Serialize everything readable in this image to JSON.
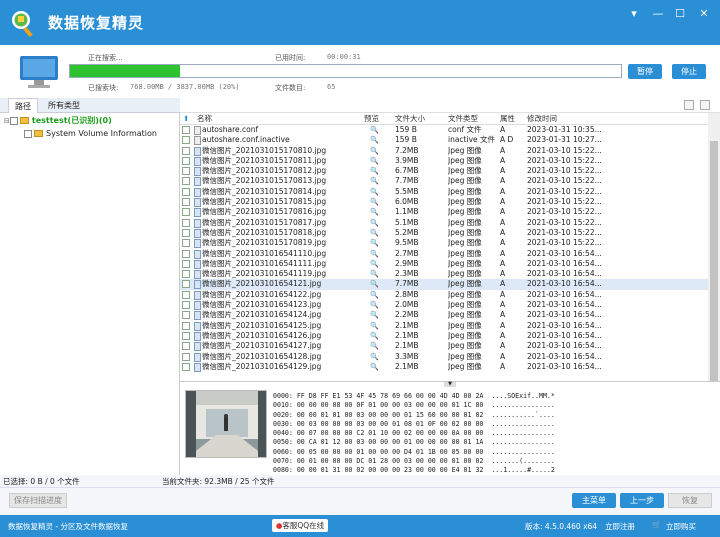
{
  "app": {
    "title": "数据恢复精灵",
    "footer_left": "数据恢复精灵 - 分区及文件数据恢复",
    "footer_service": "客服QQ在线",
    "version": "版本: 4.5.0.460 x64",
    "register": "立即注册",
    "buy": "立即购买"
  },
  "scan": {
    "status_label": "正在搜索...",
    "elapsed_label": "已用时间:",
    "elapsed": "00:00:31",
    "searched_label": "已搜索块:",
    "searched": "768.00MB / 3837.00MB (20%)",
    "files_label": "文件数目:",
    "files": "65",
    "progress": 0.2,
    "pause": "暂停",
    "stop": "停止"
  },
  "tabs": [
    "路径",
    "所有类型"
  ],
  "tree": [
    {
      "label": "testtest(已识别)(0)"
    },
    {
      "label": "System Volume Information"
    }
  ],
  "columns": {
    "name": "名称",
    "preview": "预览",
    "size": "文件大小",
    "type": "文件类型",
    "attr": "属性",
    "modified": "修改时间"
  },
  "files": [
    {
      "name": "autoshare.conf",
      "size": "159 B",
      "type": "conf 文件",
      "attr": "A",
      "time": "2023-01-31 10:35...",
      "icon": "cfg"
    },
    {
      "name": "autoshare.conf.inactive",
      "size": "159 B",
      "type": "inactive 文件",
      "attr": "A D",
      "time": "2023-01-31 10:27...",
      "icon": "cfg"
    },
    {
      "name": "微信图片_20210310151708​10.jpg",
      "size": "7.2MB",
      "type": "Jpeg 图像",
      "attr": "A",
      "time": "2021-03-10 15:22...",
      "icon": "jpg"
    },
    {
      "name": "微信图片_202103101517081​1.jpg",
      "size": "3.9MB",
      "type": "Jpeg 图像",
      "attr": "A",
      "time": "2021-03-10 15:22...",
      "icon": "jpg"
    },
    {
      "name": "微信图片_20210310151708​12.jpg",
      "size": "6.7MB",
      "type": "Jpeg 图像",
      "attr": "A",
      "time": "2021-03-10 15:22...",
      "icon": "jpg"
    },
    {
      "name": "微信图片_20210310151708​13.jpg",
      "size": "7.7MB",
      "type": "Jpeg 图像",
      "attr": "A",
      "time": "2021-03-10 15:22...",
      "icon": "jpg"
    },
    {
      "name": "微信图片_20210310151708​14.jpg",
      "size": "5.5MB",
      "type": "Jpeg 图像",
      "attr": "A",
      "time": "2021-03-10 15:22...",
      "icon": "jpg"
    },
    {
      "name": "微信图片_20210310151708​15.jpg",
      "size": "6.0MB",
      "type": "Jpeg 图像",
      "attr": "A",
      "time": "2021-03-10 15:22...",
      "icon": "jpg"
    },
    {
      "name": "微信图片_20210310151708​16.jpg",
      "size": "1.1MB",
      "type": "Jpeg 图像",
      "attr": "A",
      "time": "2021-03-10 15:22...",
      "icon": "jpg"
    },
    {
      "name": "微信图片_20210310151708​17.jpg",
      "size": "5.1MB",
      "type": "Jpeg 图像",
      "attr": "A",
      "time": "2021-03-10 15:22...",
      "icon": "jpg"
    },
    {
      "name": "微信图片_20210310151708​18.jpg",
      "size": "5.2MB",
      "type": "Jpeg 图像",
      "attr": "A",
      "time": "2021-03-10 15:22...",
      "icon": "jpg"
    },
    {
      "name": "微信图片_20210310151708​19.jpg",
      "size": "9.5MB",
      "type": "Jpeg 图像",
      "attr": "A",
      "time": "2021-03-10 15:22...",
      "icon": "jpg"
    },
    {
      "name": "微信图片_20210310165411​10.jpg",
      "size": "2.7MB",
      "type": "Jpeg 图像",
      "attr": "A",
      "time": "2021-03-10 16:54...",
      "icon": "jpg"
    },
    {
      "name": "微信图片_20210310165411​11.jpg",
      "size": "2.9MB",
      "type": "Jpeg 图像",
      "attr": "A",
      "time": "2021-03-10 16:54...",
      "icon": "jpg"
    },
    {
      "name": "微信图片_20210310165411​19.jpg",
      "size": "2.3MB",
      "type": "Jpeg 图像",
      "attr": "A",
      "time": "2021-03-10 16:54...",
      "icon": "jpg"
    },
    {
      "name": "微信图片_20210310165412​1.jpg",
      "size": "7.7MB",
      "type": "Jpeg 图像",
      "attr": "A",
      "time": "2021-03-10 16:54...",
      "icon": "jpg",
      "selected": true
    },
    {
      "name": "微信图片_20210310165412​2.jpg",
      "size": "2.8MB",
      "type": "Jpeg 图像",
      "attr": "A",
      "time": "2021-03-10 16:54...",
      "icon": "jpg"
    },
    {
      "name": "微信图片_20210310165412​3.jpg",
      "size": "2.0MB",
      "type": "Jpeg 图像",
      "attr": "A",
      "time": "2021-03-10 16:54...",
      "icon": "jpg"
    },
    {
      "name": "微信图片_20210310165412​4.jpg",
      "size": "2.2MB",
      "type": "Jpeg 图像",
      "attr": "A",
      "time": "2021-03-10 16:54...",
      "icon": "jpg"
    },
    {
      "name": "微信图片_20210310165412​5.jpg",
      "size": "2.1MB",
      "type": "Jpeg 图像",
      "attr": "A",
      "time": "2021-03-10 16:54...",
      "icon": "jpg"
    },
    {
      "name": "微信图片_20210310165412​6.jpg",
      "size": "2.1MB",
      "type": "Jpeg 图像",
      "attr": "A",
      "time": "2021-03-10 16:54...",
      "icon": "jpg"
    },
    {
      "name": "微信图片_20210310165412​7.jpg",
      "size": "2.1MB",
      "type": "Jpeg 图像",
      "attr": "A",
      "time": "2021-03-10 16:54...",
      "icon": "jpg"
    },
    {
      "name": "微信图片_20210310165412​8.jpg",
      "size": "3.3MB",
      "type": "Jpeg 图像",
      "attr": "A",
      "time": "2021-03-10 16:54...",
      "icon": "jpg"
    },
    {
      "name": "微信图片_20210310165412​9.jpg",
      "size": "2.1MB",
      "type": "Jpeg 图像",
      "attr": "A",
      "time": "2021-03-10 16:54...",
      "icon": "jpg"
    }
  ],
  "hex": [
    "0000: FF D8 FF E1 53 4F 45 78 69 66 00 00 4D 4D 00 2A  ....SOExif..MM.*",
    "0010: 00 00 00 08 00 0F 01 00 00 03 00 00 00 01 1C 80  ................",
    "0020: 00 00 01 01 00 03 00 00 00 01 15 60 00 00 01 02  ...........`....",
    "0030: 00 03 00 00 00 03 00 00 01 08 01 0F 00 02 00 00  ................",
    "0040: 00 07 00 00 00 C2 01 10 00 02 00 00 00 0A 00 00  ................",
    "0050: 00 CA 01 12 00 03 00 00 00 01 00 00 00 00 01 1A  ................",
    "0060: 00 05 00 00 00 01 00 00 00 D4 01 1B 00 05 00 00  ................",
    "0070: 00 01 00 00 00 DC 01 28 00 03 00 00 00 01 00 02  .......(........",
    "0080: 00 00 01 31 00 02 00 00 00 23 00 00 00 E4 01 32  ...1.....#.....2",
    "0090: 00 02 00 00 00 14 00 00 01 0E 02 13 00 03 00 00  ................"
  ],
  "status": {
    "selected": "已选择: 0 B / 0 个文件",
    "current": "当前文件夹: 92.3MB / 25 个文件"
  },
  "buttons": {
    "save_scan": "保存扫描进度",
    "main_menu": "主菜单",
    "prev": "上一步",
    "recover": "恢复"
  },
  "colors": {
    "title_bar": "#2b8fd6",
    "progress": "#2ec32e",
    "tree_green": "#1a9a1a"
  }
}
